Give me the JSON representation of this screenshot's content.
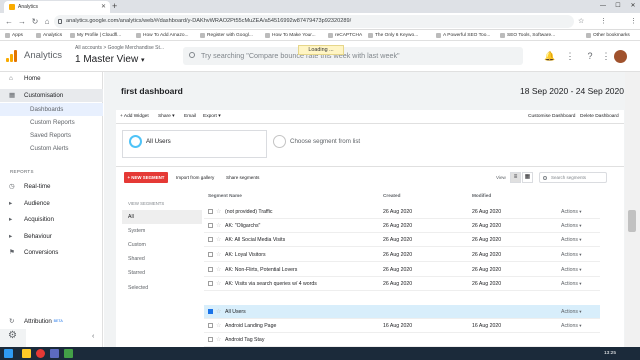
{
  "browser": {
    "tab_title": "Analytics",
    "new_tab": "+",
    "url": "analytics.google.com/analytics/web/#/dashboard/y-DAKhvWRAO2Pt55cMuZEA/a54516992w87479473p92320289/",
    "bookmarks": [
      "Apps",
      "Analytics",
      "My Profile | Cloudfl...",
      "How To Add Amazo...",
      "Register with Googl...",
      "How To Make Your...",
      "reCAPTCHA",
      "The Only 6 Keywo...",
      "A Powerful SEO Too...",
      "SEO Tools, Software...",
      "Other bookmarks"
    ]
  },
  "header": {
    "brand": "Analytics",
    "breadcrumb": "All accounts > Google Merchandise St...",
    "view": "1 Master View",
    "search_placeholder": "Try searching \"Compare bounce rate this week with last week\"",
    "loading": "Loading ..."
  },
  "sidebar": {
    "items": [
      {
        "label": "Home",
        "icon": "home-icon"
      },
      {
        "label": "Customisation",
        "icon": "customisation-icon"
      },
      {
        "label": "Dashboards"
      },
      {
        "label": "Custom Reports"
      },
      {
        "label": "Saved Reports"
      },
      {
        "label": "Custom Alerts"
      },
      {
        "label": "Real-time",
        "icon": "clock-icon"
      },
      {
        "label": "Audience",
        "icon": "person-icon"
      },
      {
        "label": "Acquisition",
        "icon": "acquisition-icon"
      },
      {
        "label": "Behaviour",
        "icon": "behaviour-icon"
      },
      {
        "label": "Conversions",
        "icon": "flag-icon"
      },
      {
        "label": "Attribution",
        "icon": "attribution-icon"
      }
    ],
    "reports_heading": "REPORTS",
    "beta": "BETA"
  },
  "dashboard": {
    "title": "first dashboard",
    "date_range": "18 Sep 2020 - 24 Sep 2020",
    "toolbar": {
      "add_widget": "+ Add Widget",
      "share": "Share",
      "email": "Email",
      "export": "Export",
      "customise": "Customise Dashboard",
      "delete": "Delete Dashboard"
    }
  },
  "segments": {
    "selected": "All Users",
    "choose": "Choose segment from list",
    "new_segment": "+ NEW SEGMENT",
    "import": "Import from gallery",
    "share": "Share segments",
    "view_label": "View",
    "search_placeholder": "Search segments",
    "view_heading": "VIEW SEGMENTS",
    "filters": [
      "All",
      "System",
      "Custom",
      "Shared",
      "Starred",
      "Selected"
    ],
    "columns": {
      "name": "Segment Name",
      "created": "Created",
      "modified": "Modified"
    },
    "rows": [
      {
        "name": "(not provided) Traffic",
        "created": "26 Aug 2020",
        "modified": "26 Aug 2020",
        "actions": "Actions"
      },
      {
        "name": "AK: \"Oligarchs\"",
        "created": "26 Aug 2020",
        "modified": "26 Aug 2020",
        "actions": "Actions"
      },
      {
        "name": "AK: All Social Media Visits",
        "created": "26 Aug 2020",
        "modified": "26 Aug 2020",
        "actions": "Actions"
      },
      {
        "name": "AK: Loyal Visitors",
        "created": "26 Aug 2020",
        "modified": "26 Aug 2020",
        "actions": "Actions"
      },
      {
        "name": "AK: Non-Flirts, Potential Lovers",
        "created": "26 Aug 2020",
        "modified": "26 Aug 2020",
        "actions": "Actions"
      },
      {
        "name": "AK: Visits via search queries w/ 4 words",
        "created": "26 Aug 2020",
        "modified": "26 Aug 2020",
        "actions": "Actions"
      },
      {
        "name": "All Users",
        "created": "",
        "modified": "",
        "actions": "Actions"
      },
      {
        "name": "Android Landing Page",
        "created": "16 Aug 2020",
        "modified": "16 Aug 2020",
        "actions": "Actions"
      },
      {
        "name": "Android Tag Stay",
        "created": "",
        "modified": "",
        "actions": ""
      }
    ]
  },
  "taskbar": {
    "time": "13:25"
  }
}
